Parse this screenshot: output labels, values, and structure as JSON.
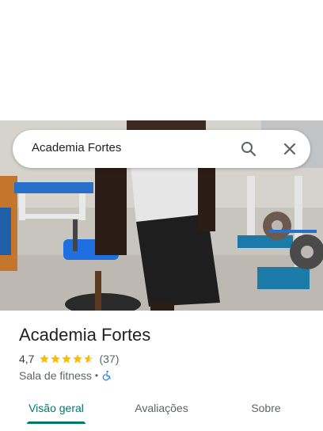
{
  "search": {
    "query": "Academia Fortes"
  },
  "place": {
    "name": "Academia Fortes",
    "rating": "4,7",
    "rating_value": 4.7,
    "review_count": "(37)",
    "category": "Sala de fitness",
    "separator": "•",
    "accessibility_icon": "wheelchair-icon"
  },
  "tabs": [
    {
      "label": "Visão geral",
      "active": true
    },
    {
      "label": "Avaliações",
      "active": false
    },
    {
      "label": "Sobre",
      "active": false
    }
  ],
  "colors": {
    "accent": "#00796b",
    "star": "#fbbc04",
    "accessibility": "#1a73e8"
  },
  "icons": {
    "search": "search-icon",
    "close": "close-icon"
  }
}
